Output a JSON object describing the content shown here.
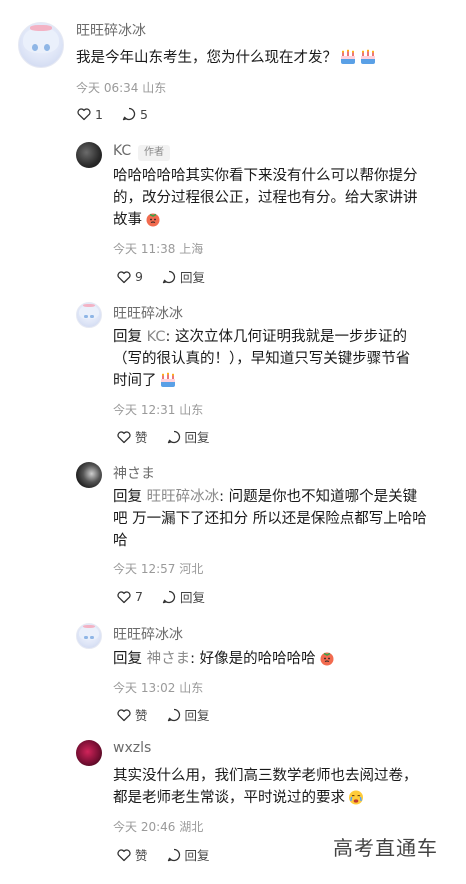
{
  "comments": [
    {
      "author": "旺旺碎冰冰",
      "text": "我是今年山东考生，您为什么现在才发？",
      "emoji": [
        "cake-emoji",
        "cake-emoji"
      ],
      "time": "今天 06:34",
      "location": "山东",
      "likes": "1",
      "replies": "5"
    }
  ],
  "replies": [
    {
      "author": "KC",
      "badge": "作者",
      "text_lines": [
        "哈哈哈哈哈其实你看下来没有什么可以帮你提分",
        "的，改分过程很公正，过程也有分。给大家讲讲",
        "故事"
      ],
      "emoji": "tomato-emoji",
      "time": "今天 11:38",
      "location": "上海",
      "likes": "9",
      "reply_label": "回复"
    },
    {
      "author": "旺旺碎冰冰",
      "reply_prefix": "回复 ",
      "reply_to": "KC",
      "text_lines": [
        "回复 KC: 这次立体几何证明我就是一步步证的",
        "（写的很认真的！），早知道只写关键步骤节省",
        "时间了"
      ],
      "line1_rest": ": 这次立体几何证明我就是一步步证的",
      "line2": "（写的很认真的！），早知道只写关键步骤节省",
      "line3": "时间了",
      "emoji": "cake-emoji",
      "time": "今天 12:31",
      "location": "山东",
      "likes": "赞",
      "reply_label": "回复"
    },
    {
      "author": "神さま",
      "reply_prefix": "回复 ",
      "reply_to": "旺旺碎冰冰",
      "line1_rest": ": 问题是你也不知道哪个是关键",
      "line2": "吧 万一漏下了还扣分 所以还是保险点都写上哈哈",
      "line3": "哈",
      "time": "今天 12:57",
      "location": "河北",
      "likes": "7",
      "reply_label": "回复"
    },
    {
      "author": "旺旺碎冰冰",
      "reply_prefix": "回复 ",
      "reply_to": "神さま",
      "line1_rest": ": 好像是的哈哈哈哈",
      "emoji": "tomato-emoji",
      "time": "今天 13:02",
      "location": "山东",
      "likes": "赞",
      "reply_label": "回复"
    },
    {
      "author": "wxzls",
      "line1": "其实没什么用，我们高三数学老师也去阅过卷，",
      "line2": "都是老师老生常谈，平时说过的要求",
      "emoji": "crying-emoji",
      "time": "今天 20:46",
      "location": "湖北",
      "likes": "赞",
      "reply_label": "回复"
    }
  ],
  "watermark": "高考直通车",
  "colors": {
    "text": "#1a1a1a",
    "muted": "#9a9a9a",
    "mention": "#8a8a8a"
  }
}
